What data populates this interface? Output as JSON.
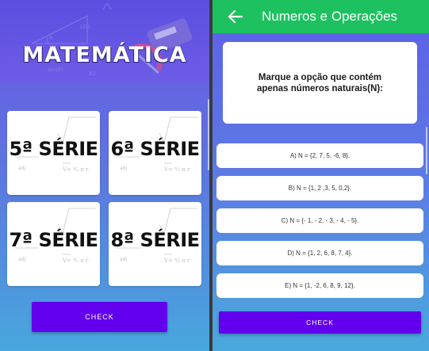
{
  "left_screen": {
    "banner_title": "MATEMÁTICA",
    "grades": [
      {
        "label": "5ª SÉRIE"
      },
      {
        "label": "6ª SÉRIE"
      },
      {
        "label": "7ª SÉRIE"
      },
      {
        "label": "8ª SÉRIE"
      }
    ],
    "check_label": "CHECK",
    "button_color": "#6200ee"
  },
  "right_screen": {
    "appbar_title": "Numeros e Operações",
    "appbar_color": "#1dc160",
    "back_icon": "arrow-left-icon",
    "question": "Marque a opção que contém apenas números naturais(N):",
    "options": [
      {
        "label": "A) N = {2, 7, 5, -6, 8}."
      },
      {
        "label": "B) N = {1, 2 ,3, 5, 0,2}."
      },
      {
        "label": "C) N = {- 1, - 2, - 3, - 4, - 5}."
      },
      {
        "label": "D) N = {1, 2, 6, 8, 7, 4}."
      },
      {
        "label": "E) N = {1, -2, 6, 8, 9, 12}."
      }
    ],
    "check_label": "CHECK"
  }
}
